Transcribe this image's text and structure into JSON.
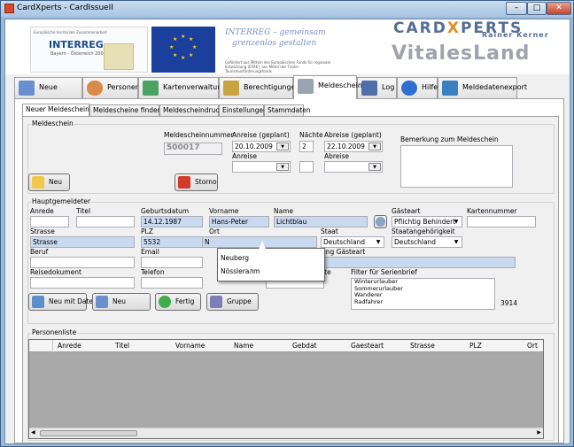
{
  "window": {
    "title": "CardXperts - CardIssueII",
    "min": "–",
    "max": "□",
    "close": "✕"
  },
  "banner": {
    "interreg": "INTERREG",
    "interreg_sub": "Bayern - Österreich 2007-2013",
    "interreg_top": "Europäische territoriale Zusammenarbeit",
    "slogan1": "INTERREG – gemeinsam",
    "slogan2": "grenzenlos gestalten",
    "funded": "Gefördert aus Mitteln des Europäischen Fonds für regionale Entwicklung (EFRE), aus Mittel des Tiroler Tourismusförderungsfonds",
    "cardx_a": "CARD",
    "cardx_x": "X",
    "cardx_b": "PERTS",
    "kerner": "Rainer Kerner",
    "vitales": "VitalesLand"
  },
  "main_tabs": [
    {
      "label": "Neue Karten",
      "icon": "new-cards-icon",
      "color": "#6a8fcf"
    },
    {
      "label": "Personen",
      "icon": "person-icon",
      "color": "#d98b4a"
    },
    {
      "label": "Kartenverwaltung",
      "icon": "card-admin-icon",
      "color": "#4aa35e"
    },
    {
      "label": "Berechtigungen",
      "icon": "key-icon",
      "color": "#c8a441"
    },
    {
      "label": "Meldeschein",
      "icon": "report-icon",
      "color": "#9aa3b0"
    },
    {
      "label": "Log",
      "icon": "clipboard-icon",
      "color": "#4f6fa8"
    },
    {
      "label": "Hilfe",
      "icon": "help-icon",
      "color": "#2f6fd1"
    },
    {
      "label": "Meldedatenexport",
      "icon": "export-icon",
      "color": "#3a7fc0"
    }
  ],
  "sub_tabs": [
    "Neuer Meldeschein",
    "Meldescheine finden",
    "Meldescheindruck",
    "Einstellungen",
    "Stammdaten"
  ],
  "meldeschein": {
    "group": "Meldeschein",
    "nr_label": "Meldescheinnummer",
    "nr": "500017",
    "anreise_geplant_label": "Anreise (geplant)",
    "anreise_geplant": "20.10.2009",
    "naechte_label": "Nächte",
    "naechte": "2",
    "abreise_geplant_label": "Abreise (geplant)",
    "abreise_geplant": "22.10.2009",
    "anreise_label": "Anreise",
    "anreise": "",
    "abreise_label": "Abreise",
    "abreise": "",
    "bemerkung_label": "Bemerkung zum Meldeschein",
    "bemerkung": "",
    "neu": "Neu",
    "storno": "Storno"
  },
  "haupt": {
    "group": "Hauptgemeldeter",
    "anrede_label": "Anrede",
    "anrede": "",
    "titel_label": "Titel",
    "titel": "",
    "geb_label": "Geburtsdatum",
    "geb": "14.12.1987",
    "vorname_label": "Vorname",
    "vorname": "Hans-Peter",
    "name_label": "Name",
    "name": "Lichtblau",
    "gaesteart_label": "Gästeart",
    "gaesteart": "Pflichtig Behindert",
    "kartennr_label": "Kartennummer",
    "kartennr": "",
    "strasse_label": "Strasse",
    "strasse": "Strasse",
    "plz_label": "PLZ",
    "plz": "5532",
    "ort_label": "Ort",
    "ort": "N",
    "staat_label": "Staat",
    "staat": "Deutschland",
    "staatsang_label": "Staatangehörigkeit",
    "staatsang": "Deutschland",
    "beruf_label": "Beruf",
    "beruf": "",
    "email_label": "Email",
    "email": "",
    "verbindung_label": "…ndung Gästeart",
    "verbindung": "",
    "reisedok_label": "Reisedokument",
    "reisedok": "",
    "telefon_label": "Telefon",
    "telefon": "",
    "alte_label": "…alte",
    "alte": "",
    "filter_label": "Filter für Serienbrief",
    "filter_items": [
      "Winterurlauber",
      "Sommerurlauber",
      "Wanderer",
      "Radfahrer"
    ],
    "count": "3914",
    "ort_suggestions": [
      "Neuberg",
      "Nösslerалm"
    ],
    "btn_neu_daten": "Neu mit Daten",
    "btn_neu": "Neu",
    "btn_fertig": "Fertig",
    "btn_gruppe": "Gruppe"
  },
  "personen": {
    "group": "Personenliste",
    "columns": [
      "Anrede",
      "Titel",
      "Vorname",
      "Name",
      "Gebdat",
      "Gaesteart",
      "Strasse",
      "PLZ",
      "Ort"
    ]
  }
}
